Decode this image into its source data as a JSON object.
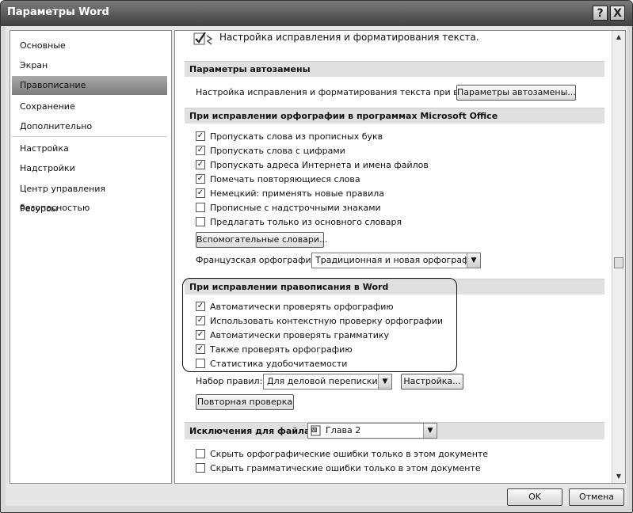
{
  "window": {
    "title": "Параметры Word",
    "help_label": "?",
    "close_label": "X"
  },
  "nav": {
    "items": [
      {
        "label": "Основные",
        "selected": false
      },
      {
        "label": "Экран",
        "selected": false
      },
      {
        "label": "Правописание",
        "selected": true
      },
      {
        "label": "Сохранение",
        "selected": false
      },
      {
        "label": "Дополнительно",
        "selected": false
      },
      {
        "label": "Настройка",
        "selected": false
      },
      {
        "label": "Надстройки",
        "selected": false
      },
      {
        "label": "Центр управления безопасностью",
        "selected": false
      },
      {
        "label": "Ресурсы",
        "selected": false
      }
    ]
  },
  "header": {
    "icon": "spellcheck-icon",
    "text": "Настройка исправления и форматирования текста."
  },
  "autocorrect": {
    "section_title": "Параметры автозамены",
    "label": "Настройка исправления и форматирования текста при вводе:",
    "button": "Параметры автозамены..."
  },
  "office_spelling": {
    "section_title": "При исправлении орфографии в программах Microsoft Office",
    "options": [
      {
        "label": "Пропускать слова из прописных букв",
        "checked": true
      },
      {
        "label": "Пропускать слова с цифрами",
        "checked": true
      },
      {
        "label": "Пропускать адреса Интернета и имена файлов",
        "checked": true
      },
      {
        "label": "Помечать повторяющиеся слова",
        "checked": true
      },
      {
        "label": "Немецкий: применять новые правила",
        "checked": true
      },
      {
        "label": "Прописные с надстрочными знаками",
        "checked": false
      },
      {
        "label": "Предлагать только из основного словаря",
        "checked": false
      }
    ],
    "dictionaries_button": "Вспомогательные словари...",
    "french_label": "Французская орфография:",
    "french_value": "Традиционная и новая орфография"
  },
  "word_spelling": {
    "section_title": "При исправлении правописания в Word",
    "options": [
      {
        "label": "Автоматически проверять орфографию",
        "checked": true
      },
      {
        "label": "Использовать контекстную проверку орфографии",
        "checked": true
      },
      {
        "label": "Автоматически проверять грамматику",
        "checked": true
      },
      {
        "label": "Также проверять орфографию",
        "checked": true
      },
      {
        "label": "Статистика удобочитаемости",
        "checked": false
      }
    ],
    "rules_label": "Набор правил:",
    "rules_value": "Для деловой переписки",
    "settings_button": "Настройка...",
    "recheck_button": "Повторная проверка"
  },
  "exceptions": {
    "section_title": "Исключения для файла:",
    "file_value": "Глава 2",
    "options": [
      {
        "label": "Скрыть орфографические ошибки только в этом документе",
        "checked": false
      },
      {
        "label": "Скрыть грамматические ошибки только в этом документе",
        "checked": false
      }
    ]
  },
  "footer": {
    "ok": "OK",
    "cancel": "Отмена"
  },
  "check_mark": "✓"
}
